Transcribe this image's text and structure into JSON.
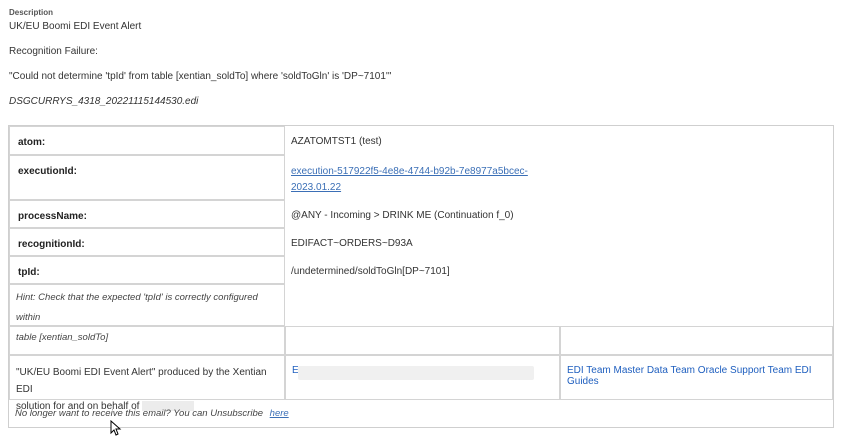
{
  "description_label": "Description",
  "alert_title": "UK/EU Boomi EDI Event Alert",
  "recognition_failure": "Recognition Failure:",
  "error_message": "\"Could not determine 'tpId' from table [xentian_soldTo] where 'soldToGln' is 'DP~7101'\"",
  "filename": "DSGCURRYS_4318_20221115144530.edi",
  "details": {
    "atom_label": "atom:",
    "atom_value": "AZATOMTST1 (test)",
    "execution_label": "executionId:",
    "execution_value_line1": "execution-517922f5-4e8e-4744-b92b-7e8977a5bcec-",
    "execution_value_line2": "2023.01.22",
    "process_label": "processName:",
    "process_value": "@ANY - Incoming > DRINK ME (Continuation f_0)",
    "recognition_label": "recognitionId:",
    "recognition_value": "EDIFACT~ORDERS~D93A",
    "tpid_label": "tpId:",
    "tpid_value": "/undetermined/soldToGln[DP~7101]"
  },
  "hint_line1": "Hint: Check that the expected 'tpId' is correctly configured within",
  "hint_line2": "table [xentian_soldTo]",
  "produced_line1": "\"UK/EU Boomi EDI Event Alert\" produced by the Xentian EDI",
  "produced_line2": "solution for and on behalf of",
  "middle_link_char": "E",
  "team_links": "EDI Team Master Data Team Oracle Support Team EDI Guides",
  "unsubscribe_text": "No longer want to receive this email? You can Unsubscribe",
  "unsubscribe_link": "here"
}
